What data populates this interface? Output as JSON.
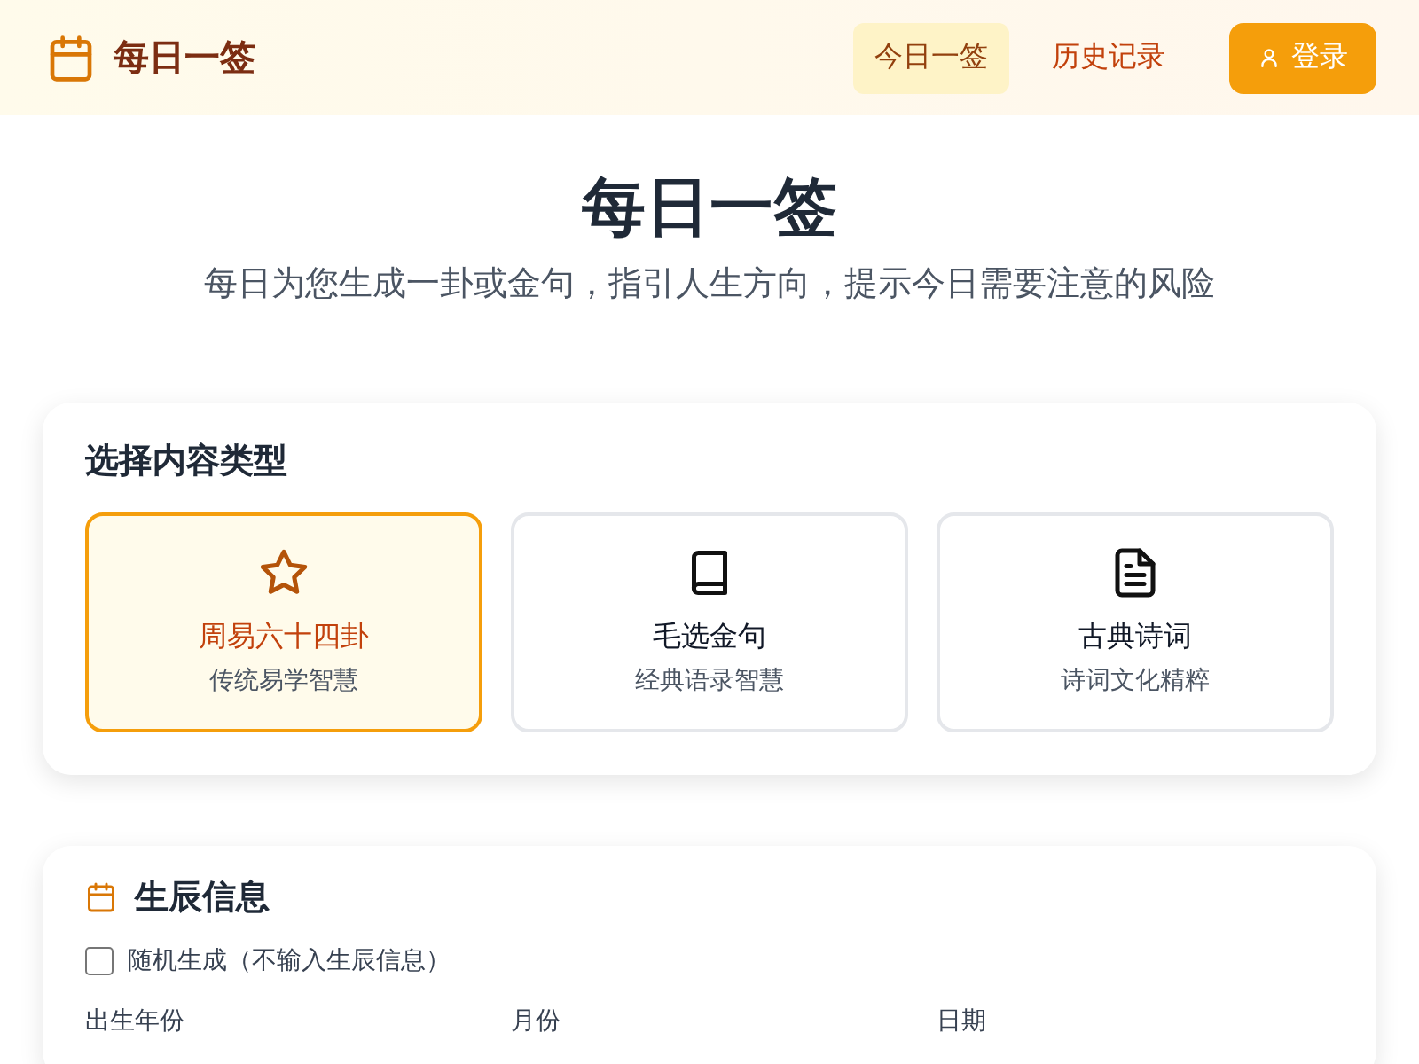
{
  "header": {
    "logo": "每日一签",
    "nav": [
      {
        "label": "今日一签",
        "selected": true
      },
      {
        "label": "历史记录",
        "selected": false
      }
    ],
    "login": "登录"
  },
  "hero": {
    "title": "每日一签",
    "subtitle": "每日为您生成一卦或金句，指引人生方向，提示今日需要注意的风险"
  },
  "content_type": {
    "title": "选择内容类型",
    "options": [
      {
        "name": "周易六十四卦",
        "desc": "传统易学智慧",
        "selected": true
      },
      {
        "name": "毛选金句",
        "desc": "经典语录智慧",
        "selected": false
      },
      {
        "name": "古典诗词",
        "desc": "诗词文化精粹",
        "selected": false
      }
    ]
  },
  "birth_info": {
    "title": "生辰信息",
    "random": {
      "label": "随机生成（不输入生辰信息）",
      "checked": false
    },
    "fields": [
      "出生年份",
      "月份",
      "日期"
    ]
  }
}
